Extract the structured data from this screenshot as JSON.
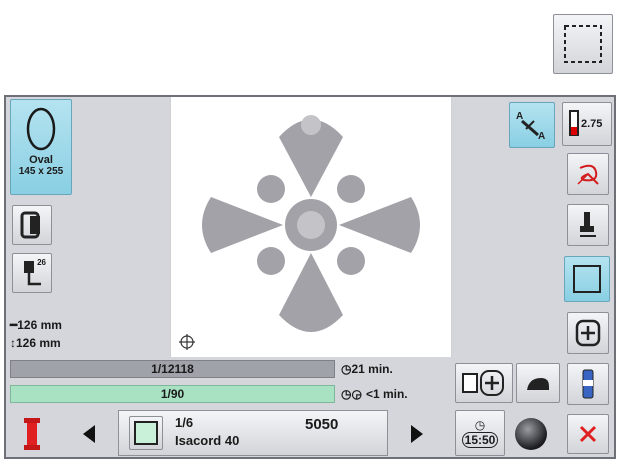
{
  "hoop": {
    "shape": "Oval",
    "size": "145 x 255"
  },
  "dimensions": {
    "width": "126 mm",
    "height": "126 mm"
  },
  "presser_foot": {
    "number": "26"
  },
  "tension": {
    "value": "2.75"
  },
  "stitch_progress": {
    "text": "1/12118"
  },
  "color_progress": {
    "text": "1/90"
  },
  "time_remaining": {
    "text": "21 min."
  },
  "color_time": {
    "text": "<1 min."
  },
  "color_info": {
    "position": "1/6",
    "thread": "Isacord 40",
    "code": "5050"
  },
  "clock": {
    "text": "15:50"
  },
  "colors": {
    "accent_blue": "#89cfe3",
    "progress_green": "#a8e2c2",
    "progress_gray": "#9fa2a9",
    "cancel_red": "#e02020"
  }
}
